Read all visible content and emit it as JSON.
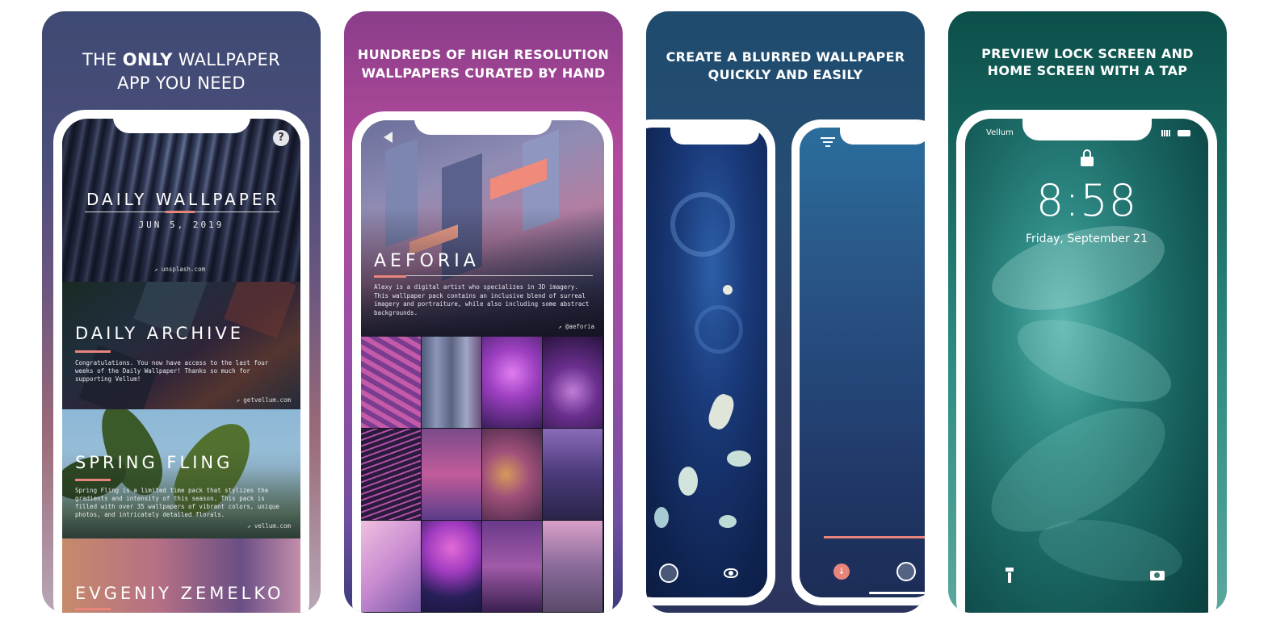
{
  "cards": [
    {
      "title_pre": "THE ",
      "title_bold": "ONLY",
      "title_post": " WALLPAPER",
      "title_line2": "APP YOU NEED",
      "sections": [
        {
          "title": "DAILY WALLPAPER",
          "subtitle": "JUN 5, 2019",
          "link": "unsplash.com"
        },
        {
          "title": "DAILY ARCHIVE",
          "desc": "Congratulations. You now have access to the last four weeks of the Daily Wallpaper! Thanks so much for supporting Vellum!",
          "link": "getvellum.com"
        },
        {
          "title": "SPRING FLING",
          "desc": "Spring Fling is a limited time pack that stylizes the gradients and intensity of this season. This pack is filled with over 35 wallpapers of vibrant colors, unique photos, and intricately detailed florals.",
          "link": "vellum.com"
        },
        {
          "title": "EVGENIY ZEMELKO"
        }
      ]
    },
    {
      "title_line1": "HUNDREDS OF HIGH RESOLUTION",
      "title_line2": "WALLPAPERS CURATED BY HAND",
      "pack_title": "AEFORIA",
      "pack_desc": "Alexy is a digital artist who specializes in 3D imagery. This wallpaper pack contains an inclusive blend of surreal imagery and portraiture, while also including some abstract backgrounds.",
      "pack_link": "@aeforia"
    },
    {
      "title_line1": "CREATE A BLURRED WALLPAPER",
      "title_line2": "QUICKLY AND EASILY"
    },
    {
      "title_line1": "PREVIEW LOCK SCREEN AND",
      "title_line2": "HOME SCREEN WITH A TAP",
      "carrier": "Vellum",
      "time": "8:58",
      "date": "Friday, September 21"
    }
  ],
  "icons": [
    "help-icon",
    "back-icon",
    "external-link-icon",
    "filter-icon",
    "lock-icon",
    "flashlight-icon",
    "camera-icon",
    "eye-icon",
    "download-icon"
  ]
}
